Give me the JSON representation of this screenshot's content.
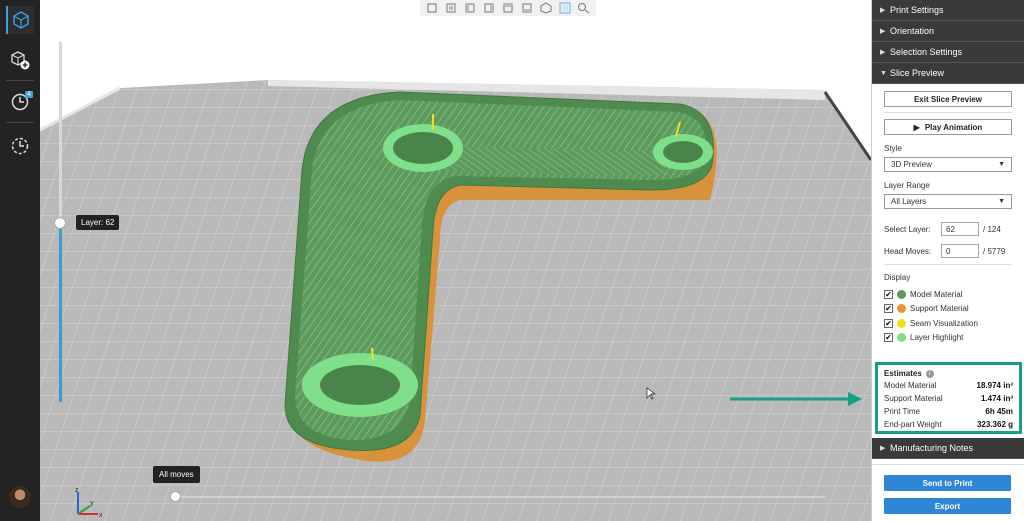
{
  "rail": {
    "history_badge": "4"
  },
  "viewport": {
    "layer_tooltip": "Layer: 62",
    "moves_tooltip": "All moves"
  },
  "panel": {
    "sections": {
      "print_settings": "Print Settings",
      "orientation": "Orientation",
      "selection_settings": "Selection Settings",
      "slice_preview": "Slice Preview",
      "manufacturing_notes": "Manufacturing Notes"
    },
    "exit_button": "Exit Slice Preview",
    "play_button": "Play Animation",
    "style_label": "Style",
    "style_value": "3D Preview",
    "layer_range_label": "Layer Range",
    "layer_range_value": "All Layers",
    "select_layer_label": "Select Layer:",
    "select_layer_value": "62",
    "select_layer_total": "/ 124",
    "head_moves_label": "Head Moves:",
    "head_moves_value": "0",
    "head_moves_total": "/ 5779",
    "display_label": "Display",
    "display_items": [
      {
        "label": "Model Material",
        "color": "#5a9a5a"
      },
      {
        "label": "Support Material",
        "color": "#e8932e"
      },
      {
        "label": "Seam Visualization",
        "color": "#f0e020"
      },
      {
        "label": "Layer Highlight",
        "color": "#7ee08a"
      }
    ],
    "estimates_label": "Estimates",
    "estimates": [
      {
        "label": "Model Material",
        "value": "18.974 in³"
      },
      {
        "label": "Support Material",
        "value": "1.474 in³"
      },
      {
        "label": "Print Time",
        "value": "6h 45m"
      },
      {
        "label": "End-part Weight",
        "value": "323.362 g"
      }
    ],
    "send_button": "Send to Print",
    "export_button": "Export"
  },
  "colors": {
    "accent": "#2f86d6",
    "highlight_box": "#14a085",
    "model_green": "#5a9a5a",
    "layer_highlight": "#7ee08a",
    "support_orange": "#e8932e"
  }
}
